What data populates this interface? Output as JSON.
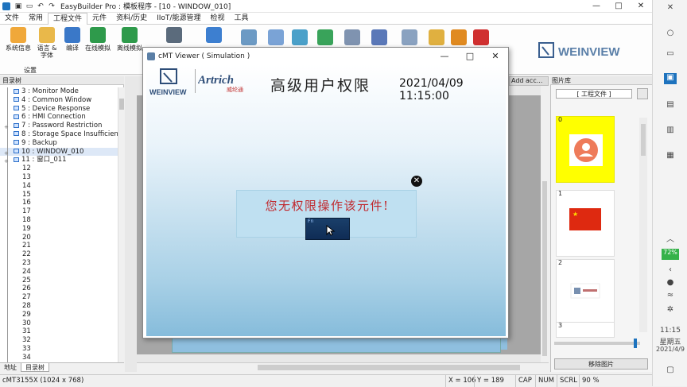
{
  "window": {
    "title": "EasyBuilder Pro : 模板程序 - [10 - WINDOW_010]",
    "minimize": "—",
    "maximize": "□",
    "close": "✕"
  },
  "menubar": {
    "items": [
      "文件",
      "常用",
      "工程文件",
      "元件",
      "资料/历史",
      "IIoT/能源管理",
      "检视",
      "工具"
    ]
  },
  "ribbon": {
    "buttons": [
      {
        "label": "系统信息",
        "icon": "gear-icon"
      },
      {
        "label": "语言 & 字体",
        "icon": "language-icon"
      },
      {
        "label": "编译",
        "icon": "compile-icon"
      },
      {
        "label": "在线模拟",
        "icon": "online-sim-icon"
      },
      {
        "label": "离线模拟",
        "icon": "offline-sim-icon"
      }
    ],
    "group_label": "设置",
    "brand": "WEINVIEW"
  },
  "tree": {
    "header": "目录树",
    "items": [
      {
        "label": "3 : Monitor Mode",
        "type": "window"
      },
      {
        "label": "4 : Common Window",
        "type": "window"
      },
      {
        "label": "5 : Device Response",
        "type": "window"
      },
      {
        "label": "6 : HMI Connection",
        "type": "window"
      },
      {
        "label": "7 : Password Restriction",
        "type": "window",
        "expand": "+"
      },
      {
        "label": "8 : Storage Space Insufficient",
        "type": "window"
      },
      {
        "label": "9 : Backup",
        "type": "window"
      },
      {
        "label": "10 : WINDOW_010",
        "type": "window",
        "expand": "+",
        "selected": true
      },
      {
        "label": "11 : 窗口_011",
        "type": "window",
        "expand": "+"
      },
      {
        "label": "12"
      },
      {
        "label": "13"
      },
      {
        "label": "14"
      },
      {
        "label": "15"
      },
      {
        "label": "16"
      },
      {
        "label": "17"
      },
      {
        "label": "18"
      },
      {
        "label": "19"
      },
      {
        "label": "20"
      },
      {
        "label": "21"
      },
      {
        "label": "22"
      },
      {
        "label": "23"
      },
      {
        "label": "24"
      },
      {
        "label": "25"
      },
      {
        "label": "26"
      },
      {
        "label": "27"
      },
      {
        "label": "28"
      },
      {
        "label": "29"
      },
      {
        "label": "30"
      },
      {
        "label": "31"
      },
      {
        "label": "32"
      },
      {
        "label": "33"
      },
      {
        "label": "34"
      }
    ],
    "tabs": [
      "地址",
      "目录树"
    ]
  },
  "tab_strip": {
    "label": "Add acc..."
  },
  "viewer": {
    "title": "cMT Viewer ( Simulation )",
    "brand1": "WEINVIEW",
    "brand2": "Artrich",
    "brand2_sub": "威纶通",
    "screen_title": "高级用户权限",
    "datetime": "2021/04/09 11:15:00",
    "popup": {
      "message": "您无权限操作该元件!",
      "button_tag": "Fn"
    }
  },
  "picture_lib": {
    "header": "图片库",
    "library_select": "[ 工程文件 ]",
    "items": [
      {
        "index": "0",
        "name": "user-avatar"
      },
      {
        "index": "1",
        "name": "china-flag"
      },
      {
        "index": "2",
        "name": "logo-image"
      },
      {
        "index": "3",
        "name": ""
      }
    ],
    "remove_button": "移除图片"
  },
  "statusbar": {
    "model": "cMT3155X (1024 x 768)",
    "x": "X = 106",
    "y": "Y = 189",
    "cap": "CAP",
    "num": "NUM",
    "scrl": "SCRL",
    "zoom": "90 %"
  },
  "side_panel": {
    "battery": "72%",
    "time": "11:15",
    "weekday": "星期五",
    "date": "2021/4/9"
  },
  "colors": {
    "accent": "#1e73be",
    "popup_text": "#c0282d",
    "selected_pic": "#ffff00",
    "hmi_gradient_bottom": "#86bcdb"
  }
}
